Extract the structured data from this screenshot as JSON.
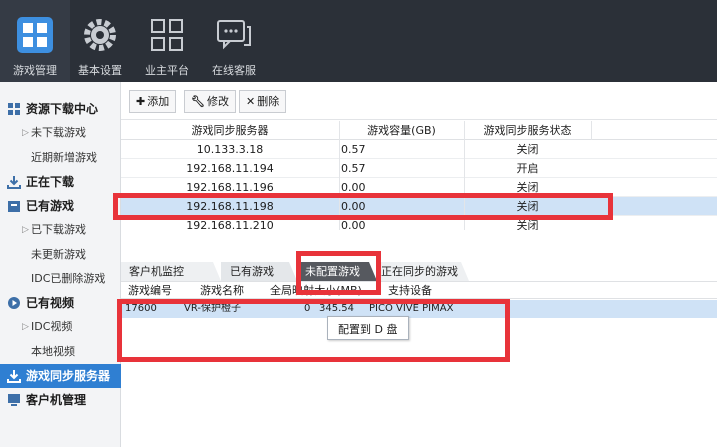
{
  "nav": {
    "items": [
      {
        "label": "游戏管理",
        "icon": "game-manage-icon"
      },
      {
        "label": "基本设置",
        "icon": "gear-icon"
      },
      {
        "label": "业主平台",
        "icon": "grid-icon"
      },
      {
        "label": "在线客服",
        "icon": "chat-icon"
      }
    ]
  },
  "sidebar": {
    "items": [
      {
        "label": "资源下载中心",
        "type": "parent"
      },
      {
        "label": "未下载游戏",
        "type": "child"
      },
      {
        "label": "近期新增游戏",
        "type": "child"
      },
      {
        "label": "正在下载",
        "type": "parent"
      },
      {
        "label": "已有游戏",
        "type": "parent"
      },
      {
        "label": "已下载游戏",
        "type": "child"
      },
      {
        "label": "未更新游戏",
        "type": "child"
      },
      {
        "label": "IDC已删除游戏",
        "type": "child"
      },
      {
        "label": "已有视频",
        "type": "parent"
      },
      {
        "label": "IDC视频",
        "type": "child"
      },
      {
        "label": "本地视频",
        "type": "child"
      },
      {
        "label": "游戏同步服务器",
        "type": "parent"
      },
      {
        "label": "客户机管理",
        "type": "parent"
      }
    ]
  },
  "toolbar": {
    "add": "添加",
    "edit": "修改",
    "delete": "删除"
  },
  "servers": {
    "headers": [
      "游戏同步服务器",
      "游戏容量(GB)",
      "游戏同步服务状态"
    ],
    "rows": [
      {
        "ip": "10.133.3.18",
        "capacity": "0.57",
        "status": "关闭"
      },
      {
        "ip": "192.168.11.194",
        "capacity": "0.57",
        "status": "开启"
      },
      {
        "ip": "192.168.11.196",
        "capacity": "0.00",
        "status": "关闭"
      },
      {
        "ip": "192.168.11.198",
        "capacity": "0.00",
        "status": "关闭"
      },
      {
        "ip": "192.168.11.210",
        "capacity": "0.00",
        "status": "关闭"
      }
    ]
  },
  "tabs": [
    "客户机监控",
    "已有游戏",
    "未配置游戏",
    "正在同步的游戏"
  ],
  "games": {
    "headers": [
      "游戏编号",
      "游戏名称",
      "全局映射",
      "大小(MB)",
      "支持设备"
    ],
    "rows": [
      {
        "id": "17600",
        "name": "VR-保护橙子",
        "global": "0",
        "size": "345.54",
        "devices": "PICO VIVE PIMAX"
      }
    ]
  },
  "context_menu": {
    "item": "配置到 D 盘"
  },
  "colors": {
    "topbar": "#2b3038",
    "selected_row": "#cfe2f6",
    "active_sidebar": "#2f7fd2",
    "highlight": "#e8333a"
  }
}
